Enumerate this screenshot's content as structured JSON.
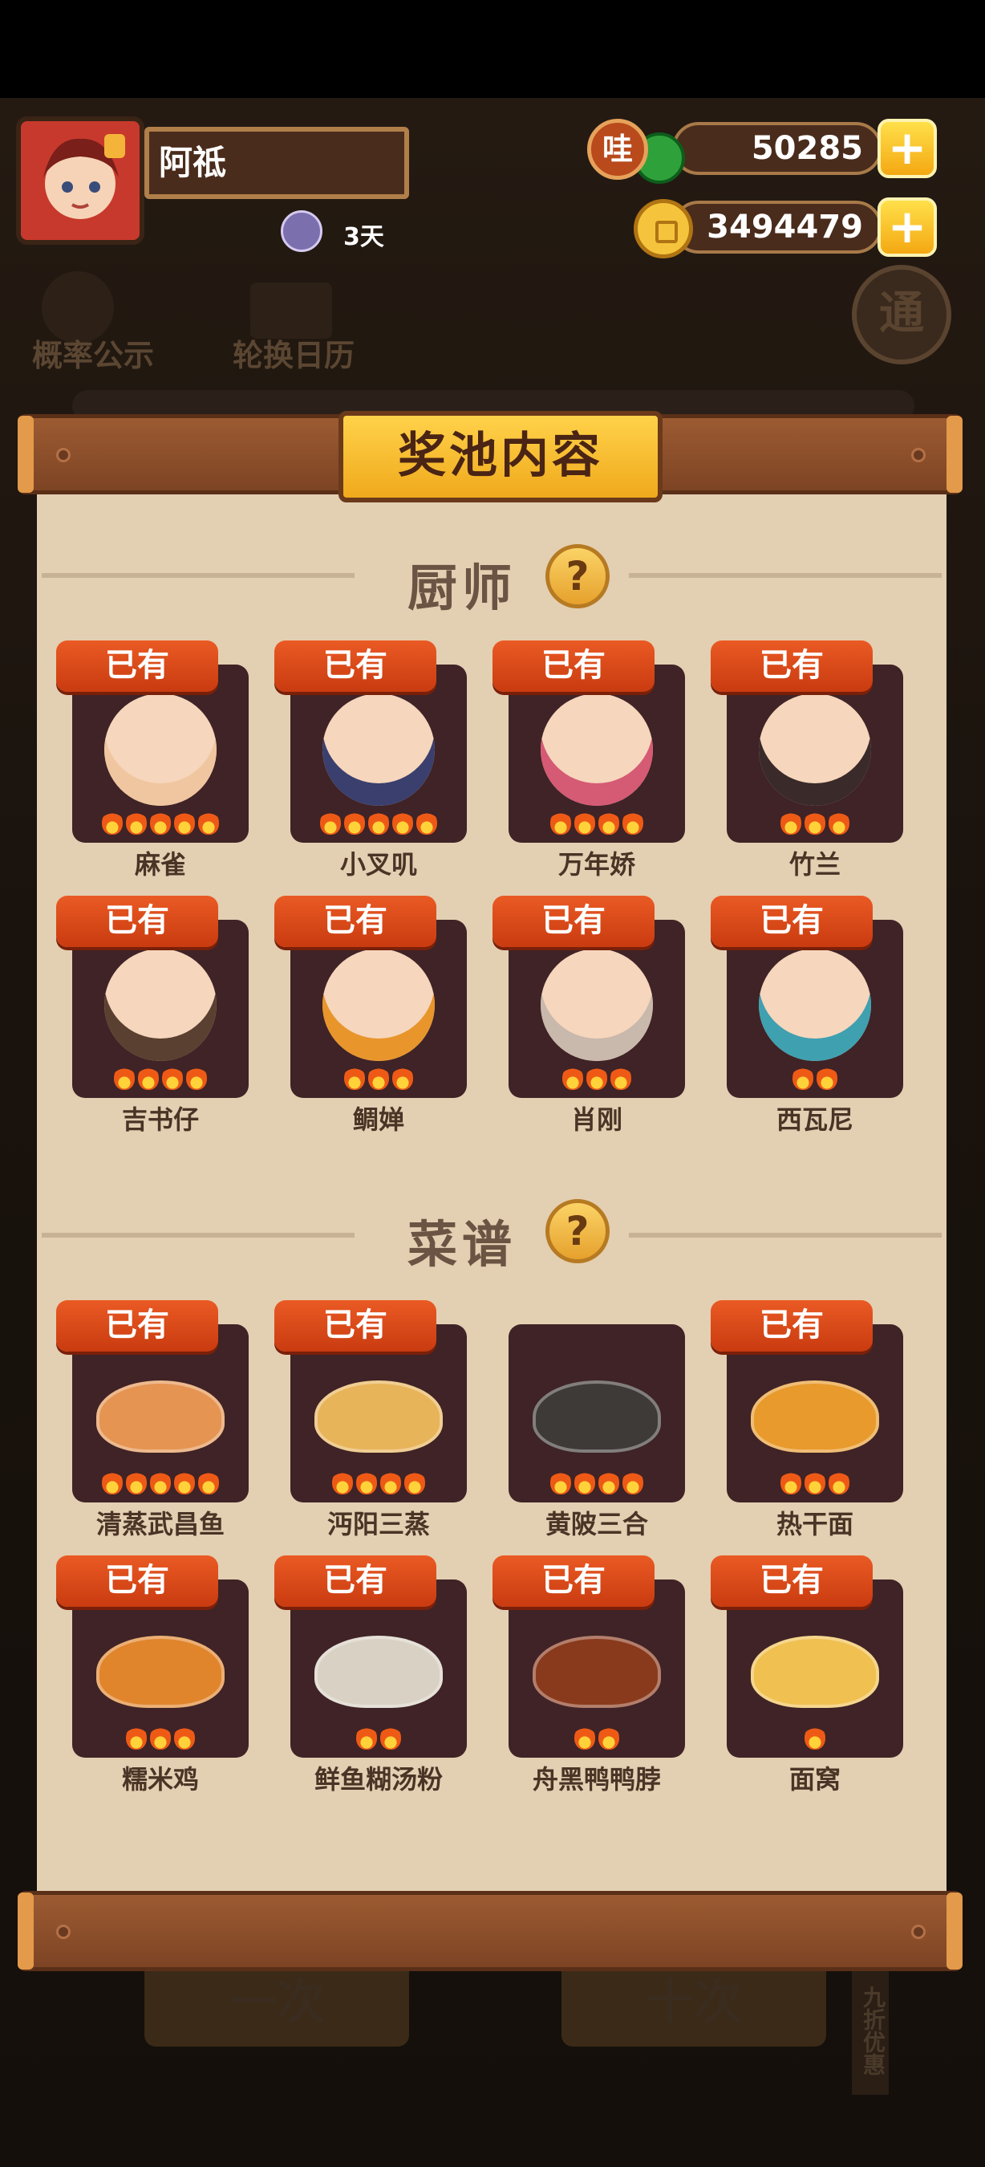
{
  "player": {
    "name": "阿祗",
    "days": "3天"
  },
  "currency": {
    "wa_icon_text": "哇",
    "jade": "50285",
    "coins": "3494479",
    "plus": "+"
  },
  "background": {
    "prob_label": "概率公示",
    "calendar_label": "轮换日历",
    "circle_text": "通"
  },
  "panel": {
    "title": "奖池内容"
  },
  "chefs": {
    "title": "厨师",
    "help": "?",
    "items": [
      {
        "name": "麻雀",
        "tag": "已有",
        "flames": 5,
        "color": "#f0c6a0"
      },
      {
        "name": "小叉叽",
        "tag": "已有",
        "flames": 5,
        "color": "#3a3f6e"
      },
      {
        "name": "万年娇",
        "tag": "已有",
        "flames": 4,
        "color": "#d55a74"
      },
      {
        "name": "竹兰",
        "tag": "已有",
        "flames": 3,
        "color": "#3a2a2a"
      },
      {
        "name": "吉书仔",
        "tag": "已有",
        "flames": 4,
        "color": "#5a4030"
      },
      {
        "name": "鲷婵",
        "tag": "已有",
        "flames": 3,
        "color": "#e8952c"
      },
      {
        "name": "肖刚",
        "tag": "已有",
        "flames": 3,
        "color": "#c9b8ac"
      },
      {
        "name": "西瓦尼",
        "tag": "已有",
        "flames": 2,
        "color": "#3fa0b0"
      }
    ]
  },
  "recipes": {
    "title": "菜谱",
    "help": "?",
    "items": [
      {
        "name": "清蒸武昌鱼",
        "tag": "已有",
        "flames": 5,
        "color": "#e59452"
      },
      {
        "name": "沔阳三蒸",
        "tag": "已有",
        "flames": 4,
        "color": "#e8b45a"
      },
      {
        "name": "黄陂三合",
        "tag": "",
        "flames": 4,
        "color": "#3e3a38"
      },
      {
        "name": "热干面",
        "tag": "已有",
        "flames": 3,
        "color": "#e89a2c"
      },
      {
        "name": "糯米鸡",
        "tag": "已有",
        "flames": 3,
        "color": "#e0852c"
      },
      {
        "name": "鲜鱼糊汤粉",
        "tag": "已有",
        "flames": 2,
        "color": "#d9d2c4"
      },
      {
        "name": "舟黑鸭鸭脖",
        "tag": "已有",
        "flames": 2,
        "color": "#8a3a1c"
      },
      {
        "name": "面窝",
        "tag": "已有",
        "flames": 1,
        "color": "#f0c050"
      }
    ]
  },
  "bottom": {
    "left_btn": "一次",
    "right_btn": "十次",
    "side_text": "九折优惠"
  }
}
